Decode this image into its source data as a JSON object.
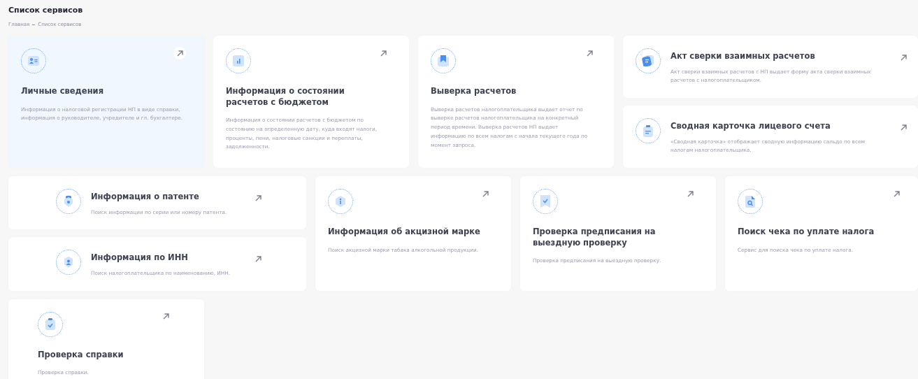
{
  "page_title": "Список сервисов",
  "breadcrumbs": [
    {
      "label": "Главная"
    },
    {
      "label": "Список сервисов"
    }
  ],
  "rows": [
    {
      "columns": [
        {
          "cards": [
            {
              "kind": "vertical",
              "selected": true,
              "title": "Личные сведения",
              "description": "Информация о налоговой регистрации НП в виде справки, информация о руководителе, учредителе и гл. бухгалтере."
            }
          ]
        },
        {
          "cards": [
            {
              "kind": "vertical",
              "selected": false,
              "title": "Информация о состоянии расчетов с бюджетом",
              "description": "Информация о состоянии расчетов с бюджетом по состоянию на определенную дату, куда входят налоги, проценты, пени, налоговые санкции и переплаты, задолженности."
            }
          ]
        },
        {
          "cards": [
            {
              "kind": "vertical",
              "selected": false,
              "title": "Выверка расчетов",
              "description": "Выверка расчетов налогоплательщика выдает отчет по выверке расчетов налогоплательщика на конкретный период времени. Выверка расчетов НП выдает информацию по всем налогам с начала текущего года по момент запроса."
            }
          ]
        },
        {
          "cards": [
            {
              "kind": "horizontal",
              "selected": false,
              "title": "Акт сверки взаимных расчетов",
              "description": "Акт сверки взаимных расчетов с НП выдает форму акта сверки взаимных расчетов с налогоплательщиком."
            },
            {
              "kind": "horizontal",
              "selected": false,
              "title": "Сводная карточка лицевого счета",
              "description": "«Сводная карточка» отображает сводную информацию сальдо по всем налогам налогоплательщика."
            }
          ]
        }
      ]
    },
    {
      "columns": [
        {
          "cards": [
            {
              "kind": "horizontal",
              "selected": false,
              "title": "Информация о патенте",
              "description": "Поиск информации по серии или номеру патента."
            },
            {
              "kind": "horizontal",
              "selected": false,
              "title": "Информация по ИНН",
              "description": "Поиск налогоплательщика по наименованию, ИНН."
            }
          ]
        },
        {
          "cards": [
            {
              "kind": "vertical",
              "selected": false,
              "title": "Информация об акцизной марке",
              "description": "Поиск акцизной марки табака алкогольной продукции."
            }
          ]
        },
        {
          "cards": [
            {
              "kind": "vertical",
              "selected": false,
              "title": "Проверка предписания на выездную проверку",
              "description": "Проверка предписания на выездную проверку."
            }
          ]
        },
        {
          "cards": [
            {
              "kind": "vertical",
              "selected": false,
              "title": "Поиск чека по уплате налога",
              "description": "Сервис для поиска чека по уплате налога."
            }
          ]
        }
      ]
    },
    {
      "columns": [
        {
          "cards": [
            {
              "kind": "vertical",
              "selected": false,
              "title": "Проверка справки",
              "description": "Проверка справки."
            }
          ]
        }
      ]
    }
  ]
}
